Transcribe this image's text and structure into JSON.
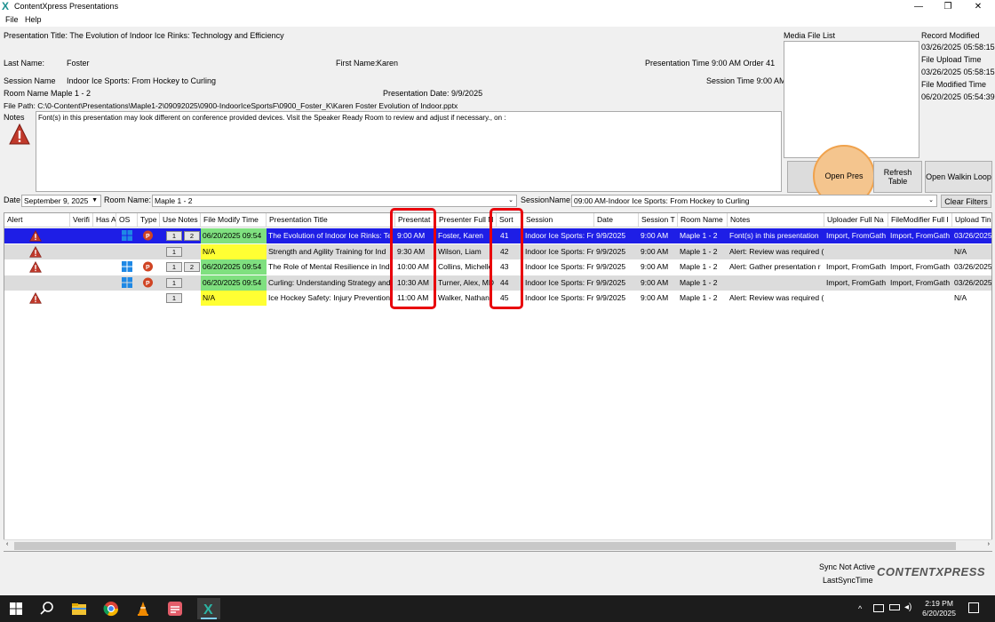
{
  "window": {
    "title": "ContentXpress Presentations",
    "minimize": "—",
    "restore": "❐",
    "close": "✕"
  },
  "menu": [
    "File",
    "Help"
  ],
  "info": {
    "presentation_title": "Presentation Title: The Evolution of Indoor Ice Rinks: Technology and Efficiency",
    "last_name_label": "Last Name:",
    "last_name": "Foster",
    "first_name_label": "First Name:",
    "first_name": "Karen",
    "pres_time": "Presentation Time 9:00 AM  Order 41",
    "session_name_label": "Session Name",
    "session_name": "Indoor Ice Sports: From Hockey to Curling",
    "session_time": "Session Time 9:00 AM",
    "room_name": "Room Name Maple 1 - 2",
    "pres_date": "Presentation Date: 9/9/2025",
    "file_path": "File Path: C:\\0-Content\\Presentations\\Maple1-2\\09092025\\0900-IndoorIceSportsF\\0900_Foster_K\\Karen Foster Evolution of Indoor.pptx",
    "notes_label": "Notes",
    "notes_text": "Font(s) in this presentation may look different on conference provided devices.  Visit the Speaker Ready Room to review and adjust if necessary.,  on :"
  },
  "media": {
    "label": "Media File List",
    "record_modified_label": "Record Modified",
    "record_modified": "03/26/2025 05:58:15",
    "file_upload_label": "File Upload Time",
    "file_upload": "03/26/2025 05:58:15",
    "file_modified_label": "File Modified Time",
    "file_modified": "06/20/2025 05:54:39"
  },
  "buttons": {
    "open_pres": "Open Pres",
    "refresh": "Refresh Table",
    "walkin": "Open Walkin Loop",
    "clear": "Clear Filters"
  },
  "filters": {
    "date_label": "Date",
    "date_value": "September 9, 2025",
    "room_label": "Room Name:",
    "room_value": "Maple 1 - 2",
    "session_label": "SessionName:",
    "session_value": "09:00 AM-Indoor Ice Sports: From Hockey to Curling"
  },
  "columns": [
    "Alert",
    "Verifi",
    "Has A",
    "OS",
    "Type",
    "Use Notes",
    "File Modify Time",
    "Presentation Title",
    "Presentat",
    "Presenter Full N",
    "Sort",
    "Session",
    "Date",
    "Session T",
    "Room Name",
    "Notes",
    "Uploader Full Na",
    "FileModifier Full I",
    "Upload Tin"
  ],
  "rows": [
    {
      "style": "sel",
      "alert": true,
      "os": true,
      "type": true,
      "notes_btns": [
        "1",
        "2"
      ],
      "modify": "06/20/2025 09:54",
      "modify_color": "green",
      "title": "The Evolution of Indoor Ice Rinks: Te",
      "time": "9:00 AM",
      "presenter": "Foster, Karen",
      "sort": "41",
      "session": "Indoor Ice Sports: Fr",
      "date": "9/9/2025",
      "stime": "9:00 AM",
      "room": "Maple 1 - 2",
      "notes": "Font(s) in this presentation",
      "uploader": "Import, FromGath",
      "modifier": "Import, FromGath",
      "upload": "03/26/2025"
    },
    {
      "style": "gray",
      "alert": true,
      "os": false,
      "type": false,
      "notes_btns": [
        "1"
      ],
      "modify": "N/A",
      "modify_color": "yellow",
      "title": "Strength and Agility Training for Ind",
      "time": "9:30 AM",
      "presenter": "Wilson, Liam",
      "sort": "42",
      "session": "Indoor Ice Sports: Fr",
      "date": "9/9/2025",
      "stime": "9:00 AM",
      "room": "Maple 1 - 2",
      "notes": "Alert: Review was required (",
      "uploader": "",
      "modifier": "",
      "upload": "N/A"
    },
    {
      "style": "white",
      "alert": true,
      "os": true,
      "type": true,
      "notes_btns": [
        "1",
        "2"
      ],
      "modify": "06/20/2025 09:54",
      "modify_color": "green",
      "title": "The Role of Mental Resilience in Ind",
      "time": "10:00 AM",
      "presenter": "Collins, Michelle",
      "sort": "43",
      "session": "Indoor Ice Sports: Fr",
      "date": "9/9/2025",
      "stime": "9:00 AM",
      "room": "Maple 1 - 2",
      "notes": "Alert: Gather presentation r",
      "uploader": "Import, FromGath",
      "modifier": "Import, FromGath",
      "upload": "03/26/2025"
    },
    {
      "style": "gray",
      "alert": false,
      "os": true,
      "type": true,
      "notes_btns": [
        "1"
      ],
      "modify": "06/20/2025 09:54",
      "modify_color": "green",
      "title": "Curling: Understanding Strategy and",
      "time": "10:30 AM",
      "presenter": "Turner, Alex, MD",
      "sort": "44",
      "session": "Indoor Ice Sports: Fr",
      "date": "9/9/2025",
      "stime": "9:00 AM",
      "room": "Maple 1 - 2",
      "notes": "",
      "uploader": "Import, FromGath",
      "modifier": "Import, FromGath",
      "upload": "03/26/2025"
    },
    {
      "style": "white",
      "alert": true,
      "os": false,
      "type": false,
      "notes_btns": [
        "1"
      ],
      "modify": "N/A",
      "modify_color": "yellow",
      "title": "Ice Hockey Safety: Injury Prevention",
      "time": "11:00 AM",
      "presenter": "Walker, Nathan",
      "sort": "45",
      "session": "Indoor Ice Sports: Fr",
      "date": "9/9/2025",
      "stime": "9:00 AM",
      "room": "Maple 1 - 2",
      "notes": "Alert: Review was required (",
      "uploader": "",
      "modifier": "",
      "upload": "N/A"
    }
  ],
  "footer": {
    "sync_status": "Sync Not Active",
    "last_sync": "LastSyncTime",
    "brand": "CONTENTXPRESS"
  },
  "taskbar": {
    "time": "2:19 PM",
    "date": "6/20/2025"
  }
}
